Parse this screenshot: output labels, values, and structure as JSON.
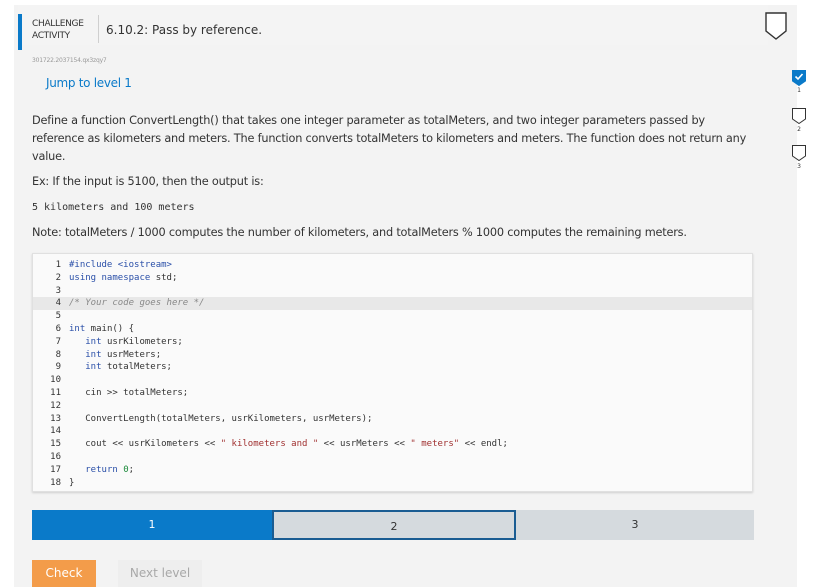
{
  "header": {
    "challenge_label": "CHALLENGE ACTIVITY",
    "title": "6.10.2: Pass by reference."
  },
  "activity_id": "301722.2037154.qx3zqy7",
  "jump_link": "Jump to level 1",
  "description": "Define a function ConvertLength() that takes one integer parameter as totalMeters, and two integer parameters passed by reference as kilometers and meters. The function converts totalMeters to kilometers and meters. The function does not return any value.",
  "example": "Ex: If the input is 5100, then the output is:",
  "output_sample": "5 kilometers and 100 meters",
  "note": "Note: totalMeters / 1000 computes the number of kilometers, and totalMeters % 1000 computes the remaining meters.",
  "code_lines": [
    {
      "n": "1",
      "t": "#include <iostream>"
    },
    {
      "n": "2",
      "t": "using namespace std;"
    },
    {
      "n": "3",
      "t": ""
    },
    {
      "n": "4",
      "t": "/* Your code goes here */"
    },
    {
      "n": "5",
      "t": ""
    },
    {
      "n": "6",
      "t": "int main() {"
    },
    {
      "n": "7",
      "t": "   int usrKilometers;"
    },
    {
      "n": "8",
      "t": "   int usrMeters;"
    },
    {
      "n": "9",
      "t": "   int totalMeters;"
    },
    {
      "n": "10",
      "t": ""
    },
    {
      "n": "11",
      "t": "   cin >> totalMeters;"
    },
    {
      "n": "12",
      "t": ""
    },
    {
      "n": "13",
      "t": "   ConvertLength(totalMeters, usrKilometers, usrMeters);"
    },
    {
      "n": "14",
      "t": ""
    },
    {
      "n": "15",
      "t": "   cout << usrKilometers << \" kilometers and \" << usrMeters << \" meters\" << endl;"
    },
    {
      "n": "16",
      "t": ""
    },
    {
      "n": "17",
      "t": "   return 0;"
    },
    {
      "n": "18",
      "t": "}"
    }
  ],
  "progress": {
    "levels": [
      "1",
      "2",
      "3"
    ],
    "current": "1"
  },
  "buttons": {
    "check": "Check",
    "next": "Next level"
  },
  "level_indicators": [
    {
      "num": "1",
      "done": true
    },
    {
      "num": "2",
      "done": false
    },
    {
      "num": "3",
      "done": false
    }
  ],
  "colors": {
    "accent": "#0a7ac9",
    "check_button": "#f39c4a",
    "segment_inactive": "#d5dade"
  }
}
